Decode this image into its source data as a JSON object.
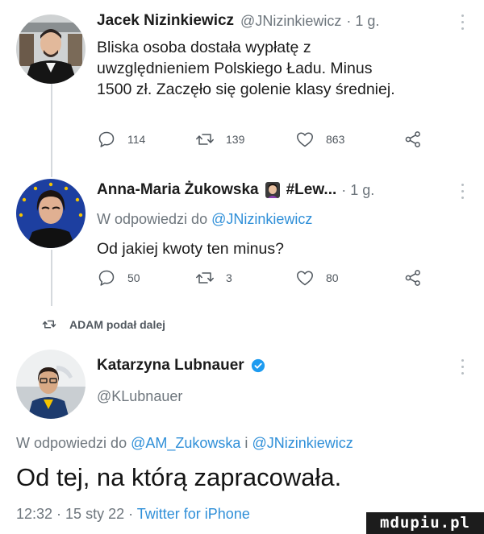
{
  "tweets": [
    {
      "author_name": "Jacek Nizinkiewicz",
      "handle": "@JNizinkiewicz",
      "time": "· 1 g.",
      "body_lines": [
        "Bliska osoba dostała wypłatę z",
        "uwzględnieniem Polskiego Ładu. Minus",
        "1500 zł. Zaczęło się golenie klasy średniej."
      ],
      "replies": "114",
      "retweets": "139",
      "likes": "863"
    },
    {
      "author_name": "Anna-Maria Żukowska",
      "name_suffix": "#Lew...",
      "time": "· 1 g.",
      "reply_prefix": "W odpowiedzi do",
      "reply_to": "@JNizinkiewicz",
      "body": "Od jakiej kwoty ten minus?",
      "replies": "50",
      "retweets": "3",
      "likes": "80"
    }
  ],
  "retweet_notice": "ADAM podał dalej",
  "focus": {
    "author_name": "Katarzyna Lubnauer",
    "handle": "@KLubnauer",
    "reply_prefix": "W odpowiedzi do",
    "reply_to_1": "@AM_Zukowska",
    "reply_joiner": "i",
    "reply_to_2": "@JNizinkiewicz",
    "text": "Od tej, na którą zapracowała.",
    "timestamp": "12:32 · 15 sty 22 ·",
    "source": "Twitter for iPhone"
  },
  "watermark": "mdupiu.pl",
  "colors": {
    "link": "#2f8fd8",
    "muted": "#6e767d",
    "verified": "#1d9bf0"
  }
}
